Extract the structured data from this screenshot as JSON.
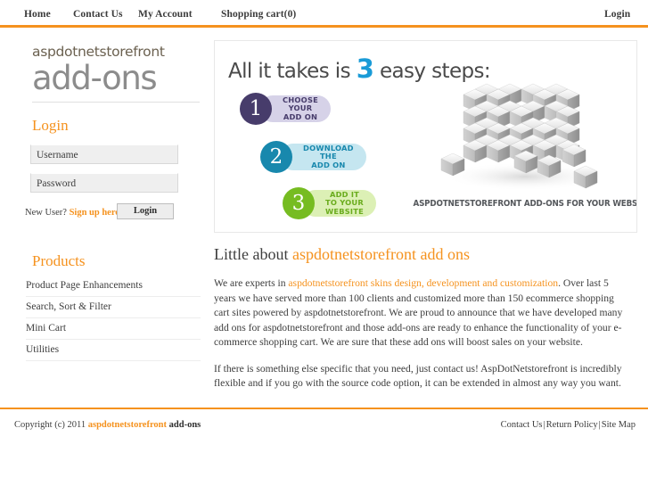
{
  "header": {
    "nav": [
      {
        "id": "home",
        "label": "Home"
      },
      {
        "id": "contact",
        "label": "Contact Us"
      },
      {
        "id": "account",
        "label": "My Account"
      },
      {
        "id": "cart",
        "label": "Shopping cart(0)"
      }
    ],
    "login_label": "Login",
    "accent_rule_color": "#f5921e"
  },
  "sidebar": {
    "logo": {
      "top_text": "aspdotnetstorefront",
      "bottom_text": "add-ons",
      "top_color": "#6b6150",
      "bottom_color": "#8c8c8c"
    },
    "login": {
      "heading": "Login",
      "username_label": "Username",
      "username_value": "",
      "username_placeholder": "",
      "password_label": "Password",
      "password_value": "",
      "password_placeholder": "",
      "newuser_text": "New User? ",
      "signup_label": "Sign up here",
      "submit_label": "Login"
    },
    "products": {
      "heading": "Products",
      "items": [
        {
          "label": "Product Page Enhancements"
        },
        {
          "label": "Search, Sort & Filter"
        },
        {
          "label": "Mini Cart"
        },
        {
          "label": "Utilities"
        }
      ]
    }
  },
  "banner": {
    "headline_before": "All it takes is ",
    "headline_number": "3",
    "headline_after": " easy steps:",
    "number_color": "#1a9bd7",
    "steps": [
      {
        "number": "1",
        "text": "CHOOSE YOUR\nADD ON",
        "circle_color": "#473c6b",
        "pill_color": "#d6d2e8"
      },
      {
        "number": "2",
        "text": "DOWNLOAD THE\nADD ON",
        "circle_color": "#1888ad",
        "pill_color": "#c5e6f0"
      },
      {
        "number": "3",
        "text": "ADD IT TO YOUR\nWEBSITE",
        "circle_color": "#76bc21",
        "pill_color": "#dcf0b5"
      }
    ],
    "tagline": "ASPDOTNETSTOREFRONT ADD-ONS FOR YOUR WEBSTORE",
    "artwork": "cube-stack-illustration"
  },
  "main": {
    "title_plain": "Little about ",
    "title_accent": "aspdotnetstorefront add ons",
    "paragraph1_lead": "We are experts in ",
    "paragraph1_link": "aspdotnetstorefront skins design, development and customization",
    "paragraph1_rest": ". Over last 5 years we have served more than 100 clients and customized more than 150 ecommerce shopping cart sites powered by aspdotnetstorefront. We are proud to announce that we have developed many add ons for aspdotnetstorefront and those add-ons are ready to enhance the functionality of your e-commerce shopping cart. We are sure that these add ons will boost sales on your website.",
    "paragraph2": "If there is something else specific that you need, just contact us! AspDotNetstorefront is incredibly flexible and if you go with the source code option, it can be extended in almost any way you want."
  },
  "footer": {
    "copyright_prefix": "Copyright (c) 2011 ",
    "copyright_brand_orange": "aspdotnetstorefront",
    "copyright_brand_dark": " add-ons",
    "links": [
      {
        "label": "Contact Us"
      },
      {
        "label": "Return Policy"
      },
      {
        "label": "Site Map"
      }
    ],
    "separator": "|"
  }
}
